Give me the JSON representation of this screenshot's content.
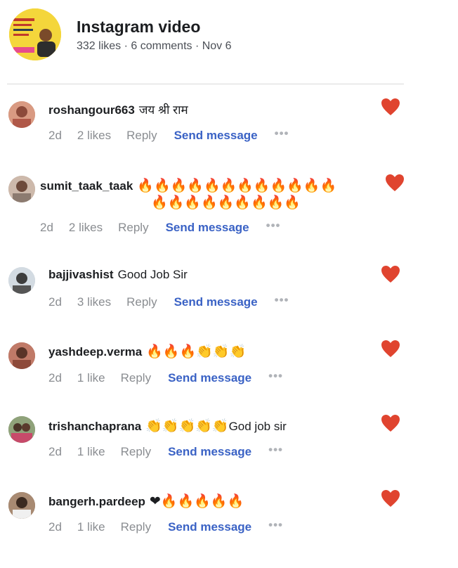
{
  "post": {
    "title": "Instagram video",
    "meta": "332 likes · 6 comments · Nov 6"
  },
  "comments": [
    {
      "username": "roshangour663",
      "text": "जय श्री राम",
      "age": "2d",
      "likes": "2 likes",
      "reply": "Reply",
      "send": "Send message",
      "more": "•••"
    },
    {
      "username": "sumit_taak_taak",
      "emoji_line1": "🔥🔥🔥🔥🔥🔥🔥🔥🔥🔥🔥🔥",
      "emoji_line2": "🔥🔥🔥🔥🔥🔥🔥🔥🔥",
      "age": "2d",
      "likes": "2 likes",
      "reply": "Reply",
      "send": "Send message",
      "more": "•••"
    },
    {
      "username": "bajjivashist",
      "text": "Good Job Sir",
      "age": "2d",
      "likes": "3 likes",
      "reply": "Reply",
      "send": "Send message",
      "more": "•••"
    },
    {
      "username": "yashdeep.verma",
      "emoji": "🔥🔥🔥👏👏👏",
      "age": "2d",
      "likes": "1 like",
      "reply": "Reply",
      "send": "Send message",
      "more": "•••"
    },
    {
      "username": "trishanchaprana",
      "emoji": "👏👏👏👏👏",
      "text": "God job sir",
      "age": "2d",
      "likes": "1 like",
      "reply": "Reply",
      "send": "Send message",
      "more": "•••"
    },
    {
      "username": "bangerh.pardeep",
      "emoji": "❤🔥🔥🔥🔥🔥",
      "age": "2d",
      "likes": "1 like",
      "reply": "Reply",
      "send": "Send message",
      "more": "•••"
    }
  ],
  "colors": {
    "heart": "#e0442f",
    "link": "#3a62c5",
    "muted": "#8a8d91"
  }
}
